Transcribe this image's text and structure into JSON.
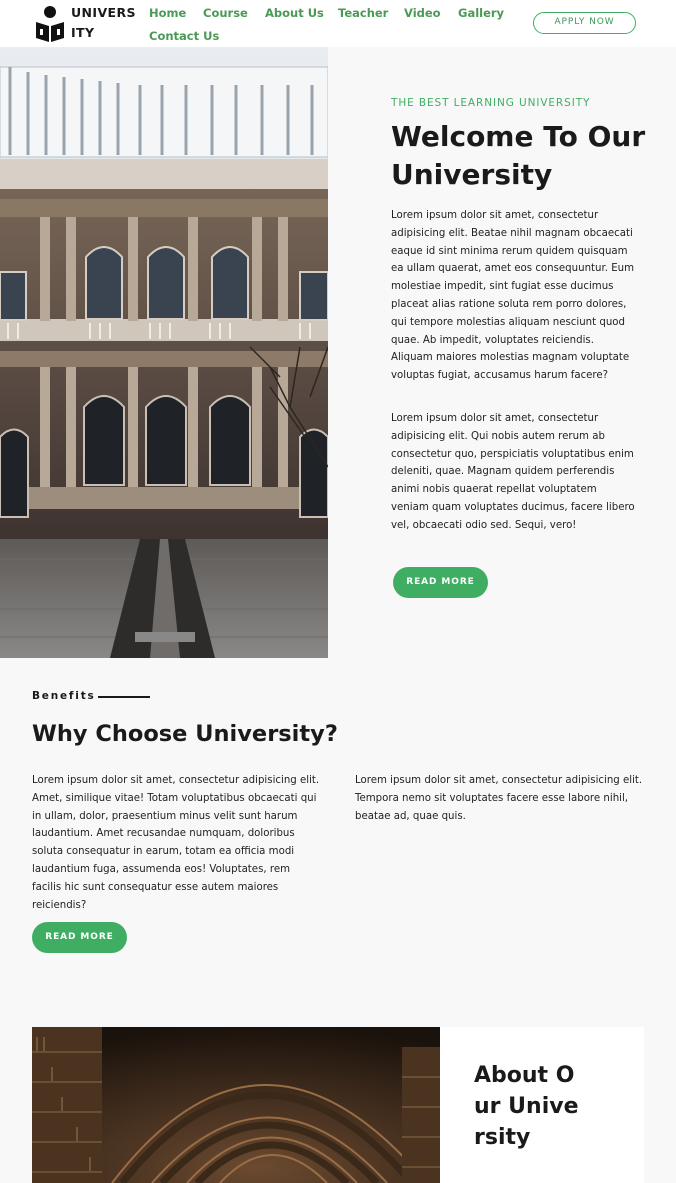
{
  "header": {
    "logo_text": "UNIVERSITY",
    "nav": [
      "Home",
      "Course",
      "About Us",
      "Teacher",
      "Video",
      "Gallery",
      "Contact Us"
    ],
    "apply_label": "APPLY NOW"
  },
  "hero": {
    "kicker": "THE BEST LEARNING UNIVERSITY",
    "title": "Welcome To Our University",
    "paragraph1": "Lorem ipsum dolor sit amet, consectetur adipisicing elit. Beatae nihil magnam obcaecati eaque id sint minima rerum quidem quisquam ea ullam quaerat, amet eos consequuntur. Eum molestiae impedit, sint fugiat esse ducimus placeat alias ratione soluta rem porro dolores, qui tempore molestias aliquam nesciunt quod quae. Ab impedit, voluptates reiciendis. Aliquam maiores molestias magnam voluptate voluptas fugiat, accusamus harum facere?",
    "paragraph2": "Lorem ipsum dolor sit amet, consectetur adipisicing elit. Qui nobis autem rerum ab consectetur quo, perspiciatis voluptatibus enim deleniti, quae. Magnam quidem perferendis animi nobis quaerat repellat voluptatem veniam quam voluptates ducimus, facere libero vel, obcaecati odio sed. Sequi, vero!",
    "read_more": "READ MORE"
  },
  "benefits": {
    "label": "Benefits",
    "title": "Why Choose University?",
    "col1": "Lorem ipsum dolor sit amet, consectetur adipisicing elit. Amet, similique vitae! Totam voluptatibus obcaecati qui in ullam, dolor, praesentium minus velit sunt harum laudantium. Amet recusandae numquam, doloribus soluta consequatur in earum, totam ea officia modi laudantium fuga, assumenda eos! Voluptates, rem facilis hic sunt consequatur esse autem maiores reiciendis?",
    "col2": "Lorem ipsum dolor sit amet, consectetur adipisicing elit. Tempora nemo sit voluptates facere esse labore nihil, beatae ad, quae quis.",
    "read_more": "READ MORE"
  },
  "about": {
    "title": "About Our University"
  },
  "colors": {
    "accent": "#3fae63",
    "nav_text": "#4a9a55",
    "background": "#f8f8f8",
    "heading": "#1a1a1a"
  },
  "icons": {
    "logo": "student-reading-book-logo"
  }
}
